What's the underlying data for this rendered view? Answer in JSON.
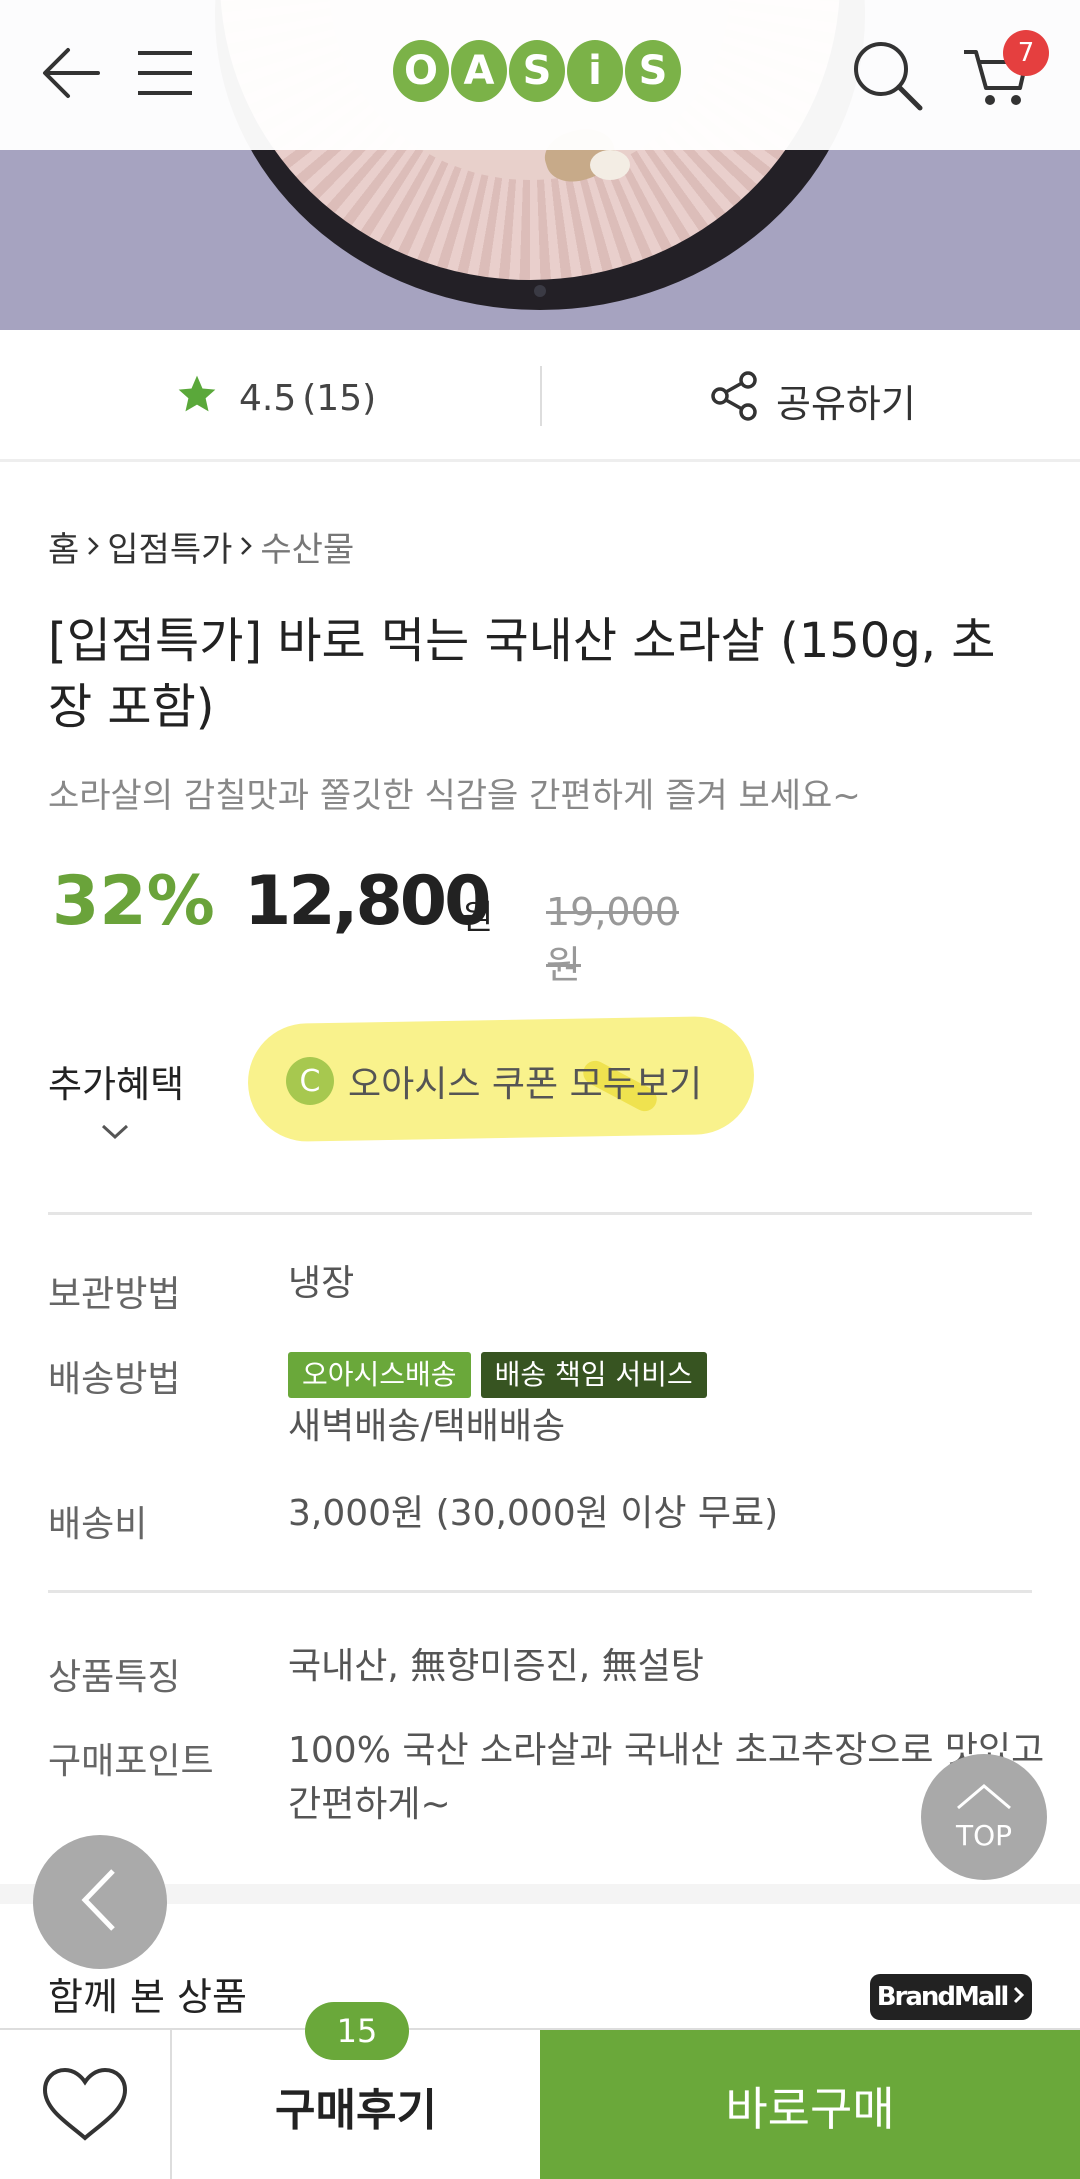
{
  "header": {
    "logo_letters": [
      "O",
      "A",
      "S",
      "i",
      "S"
    ],
    "cart_count": "7"
  },
  "rating": {
    "score": "4.5",
    "count": "(15)",
    "share_label": "공유하기"
  },
  "breadcrumb": [
    "홈",
    "입점특가",
    "수산물"
  ],
  "product": {
    "title": "[입점특가] 바로 먹는 국내산 소라살 (150g, 초장 포함)",
    "subtitle": "소라살의 감칠맛과 쫄깃한 식감을 간편하게 즐겨 보세요~",
    "discount": "32%",
    "price": "12,800",
    "price_unit": "원",
    "original_price": "19,000원"
  },
  "benefit": {
    "label": "추가혜택",
    "coupon_icon": "C",
    "coupon_text": "오아시스 쿠폰 모두보기"
  },
  "info": {
    "storage_key": "보관방법",
    "storage_val": "냉장",
    "delivery_key": "배송방법",
    "delivery_tag1": "오아시스배송",
    "delivery_tag2": "배송 책임 서비스",
    "delivery_val": "새벽배송/택배배송",
    "fee_key": "배송비",
    "fee_val": "3,000원 (30,000원 이상 무료)",
    "feature_key": "상품특징",
    "feature_val": "국내산, 無향미증진, 無설탕",
    "point_key": "구매포인트",
    "point_val": "100% 국산 소라살과 국내산 초고추장으로 맛있고 간편하게~"
  },
  "related": {
    "title": "함께 본 상품",
    "brandmall": "BrandMall"
  },
  "fab": {
    "top_label": "TOP"
  },
  "bottom": {
    "review_label": "구매후기",
    "review_count": "15",
    "buy_label": "바로구매"
  },
  "colors": {
    "brand_green": "#6aa83a",
    "dark_green": "#375421",
    "badge_red": "#e53f3f",
    "highlight_yellow": "#f9f28c"
  }
}
